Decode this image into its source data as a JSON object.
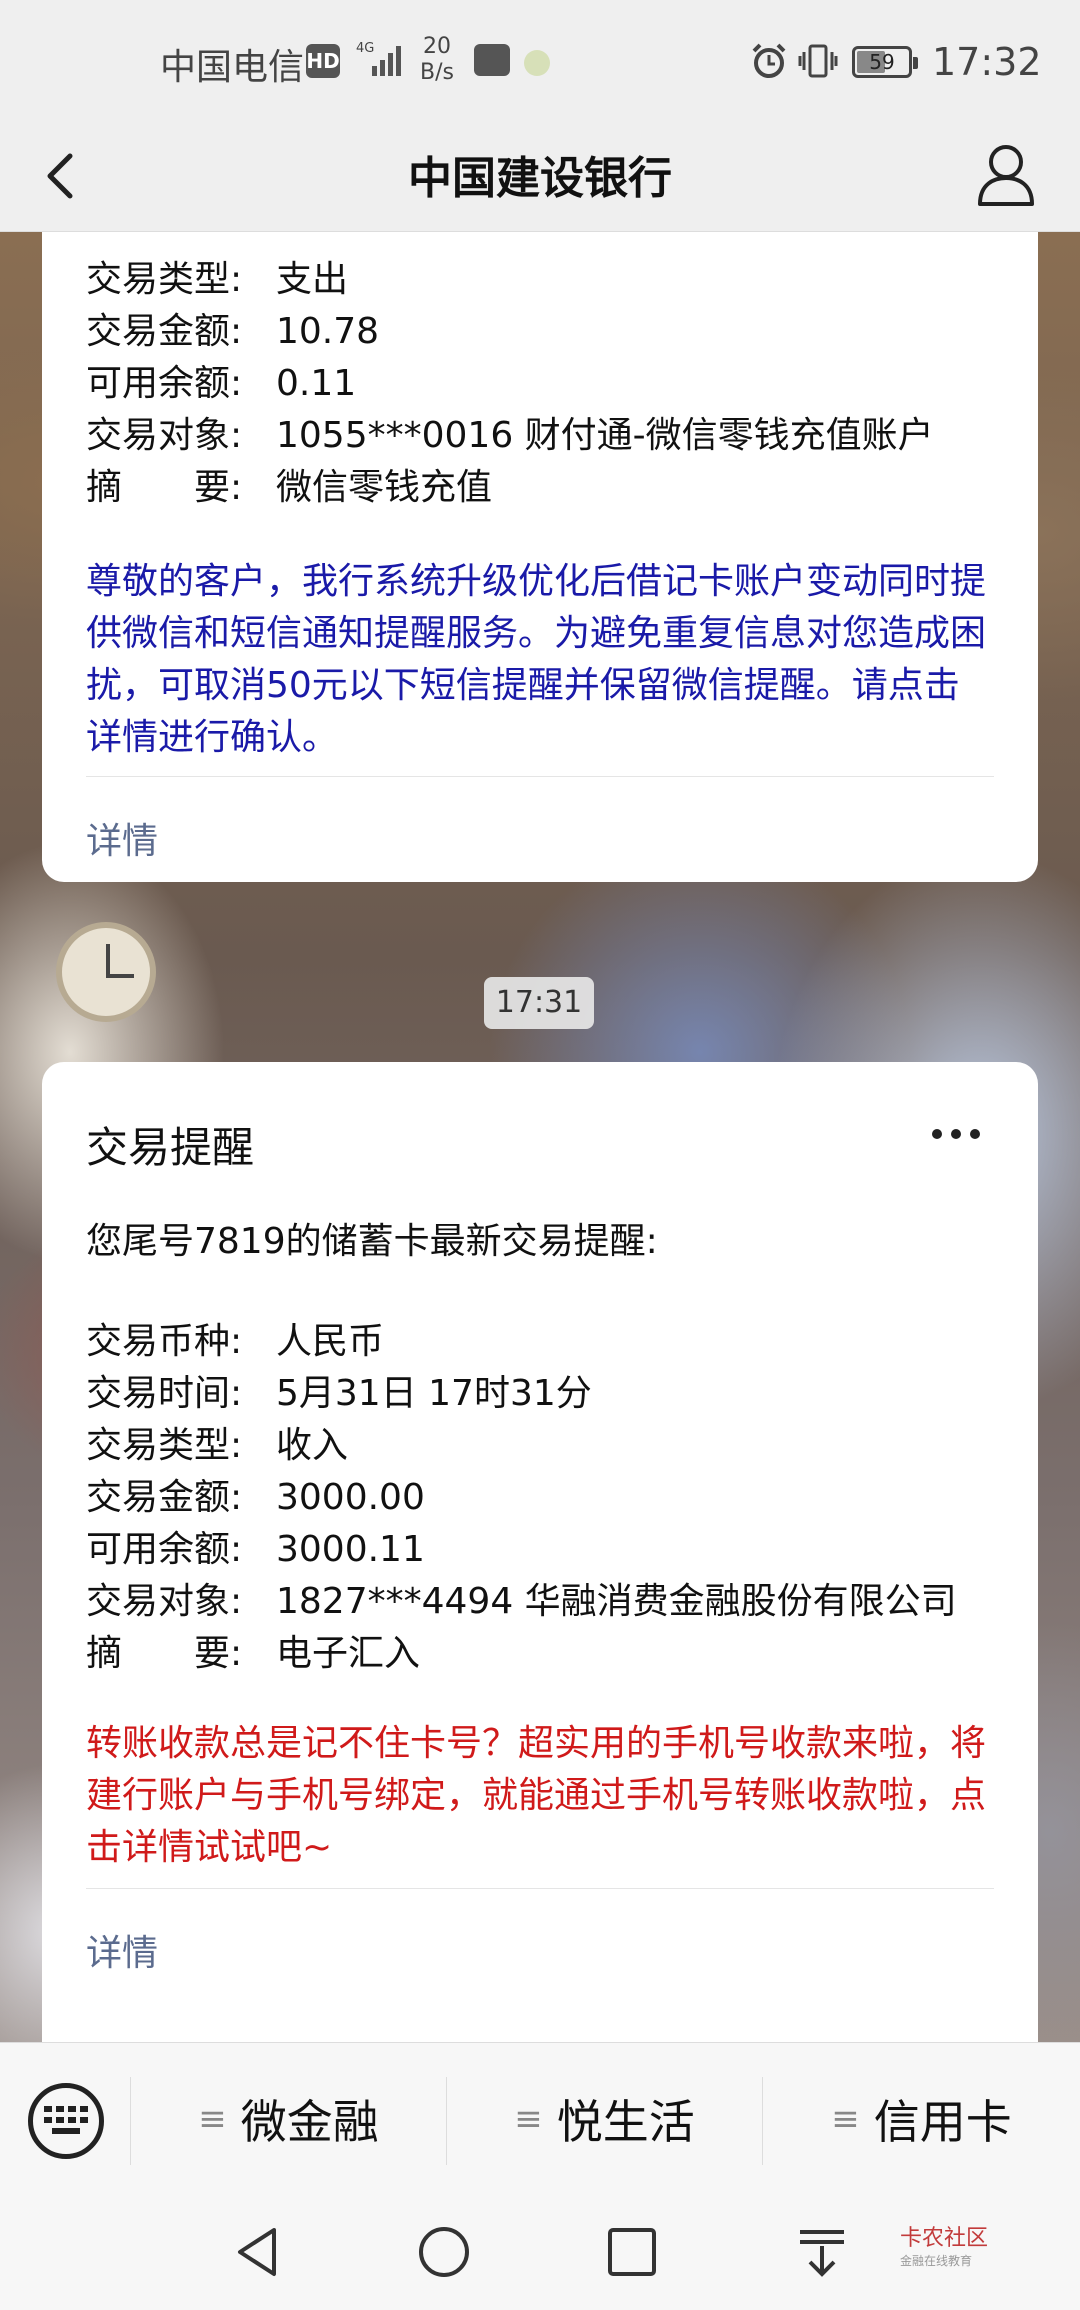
{
  "status_bar": {
    "carrier": "中国电信",
    "hd": "HD",
    "network": "4G",
    "speed_value": "20",
    "speed_unit": "B/s",
    "battery": "59",
    "time": "17:32"
  },
  "header": {
    "title": "中国建设银行"
  },
  "card1": {
    "rows": [
      {
        "label": "交易类型:",
        "value": "支出"
      },
      {
        "label": "交易金额:",
        "value": "10.78"
      },
      {
        "label": "可用余额:",
        "value": "0.11"
      },
      {
        "label": "交易对象:",
        "value": "1055***0016 财付通-微信零钱充值账户"
      },
      {
        "label": "摘　　要:",
        "value": "微信零钱充值"
      }
    ],
    "notice": "尊敬的客户，我行系统升级优化后借记卡账户变动同时提供微信和短信通知提醒服务。为避免重复信息对您造成困扰，可取消50元以下短信提醒并保留微信提醒。请点击详情进行确认。",
    "detail_label": "详情"
  },
  "timestamp": "17:31",
  "card2": {
    "title": "交易提醒",
    "intro": "您尾号7819的储蓄卡最新交易提醒:",
    "rows": [
      {
        "label": "交易币种:",
        "value": "人民币"
      },
      {
        "label": "交易时间:",
        "value": "5月31日 17时31分"
      },
      {
        "label": "交易类型:",
        "value": "收入"
      },
      {
        "label": "交易金额:",
        "value": "3000.00"
      },
      {
        "label": "可用余额:",
        "value": "3000.11"
      },
      {
        "label": "交易对象:",
        "value": "1827***4494 华融消费金融股份有限公司"
      },
      {
        "label": "摘　　要:",
        "value": "电子汇入"
      }
    ],
    "notice": "转账收款总是记不住卡号？超实用的手机号收款来啦，将建行账户与手机号绑定，就能通过手机号转账收款啦，点击详情试试吧~",
    "detail_label": "详情"
  },
  "menu": {
    "items": [
      {
        "label": "微金融"
      },
      {
        "label": "悦生活"
      },
      {
        "label": "信用卡"
      }
    ]
  },
  "watermark": {
    "brand": "卡农社区",
    "sub": "金融在线教育"
  },
  "colors": {
    "notice_blue": "#1a1aa8",
    "notice_red": "#d01a1a",
    "link": "#5b6b8e"
  }
}
